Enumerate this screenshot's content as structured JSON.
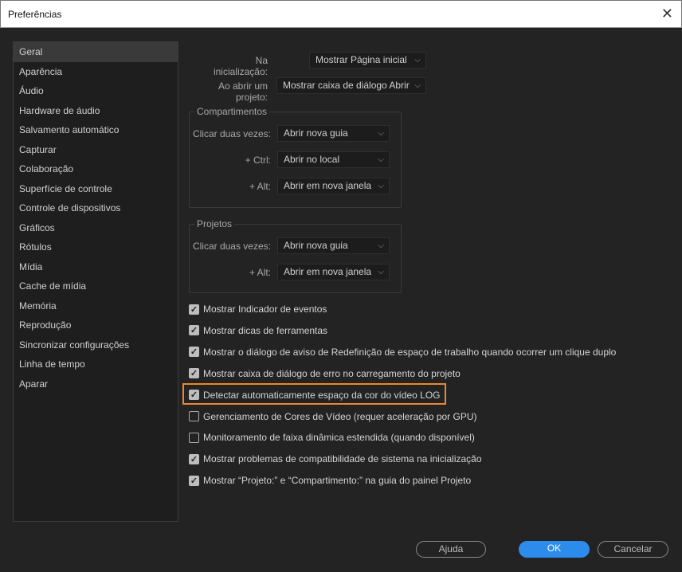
{
  "window": {
    "title": "Preferências"
  },
  "sidebar": {
    "items": [
      "Geral",
      "Aparência",
      "Áudio",
      "Hardware de áudio",
      "Salvamento automático",
      "Capturar",
      "Colaboração",
      "Superfície de controle",
      "Controle de dispositivos",
      "Gráficos",
      "Rótulos",
      "Mídia",
      "Cache de mídia",
      "Memória",
      "Reprodução",
      "Sincronizar configurações",
      "Linha de tempo",
      "Aparar"
    ],
    "selected": "Geral"
  },
  "general": {
    "startup_label": "Na inicialização:",
    "startup_value": "Mostrar Página inicial",
    "open_label": "Ao abrir um projeto:",
    "open_value": "Mostrar caixa de diálogo Abrir"
  },
  "bins": {
    "title": "Compartimentos",
    "rows": [
      {
        "label": "Clicar duas vezes:",
        "value": "Abrir nova guia"
      },
      {
        "label": "+ Ctrl:",
        "value": "Abrir no local"
      },
      {
        "label": "+ Alt:",
        "value": "Abrir em nova janela"
      }
    ]
  },
  "projects": {
    "title": "Projetos",
    "rows": [
      {
        "label": "Clicar duas vezes:",
        "value": "Abrir nova guia"
      },
      {
        "label": "+ Alt:",
        "value": "Abrir em nova janela"
      }
    ]
  },
  "checkboxes": [
    {
      "label": "Mostrar Indicador de eventos",
      "checked": true
    },
    {
      "label": "Mostrar dicas de ferramentas",
      "checked": true
    },
    {
      "label": "Mostrar o diálogo de aviso de Redefinição de espaço de trabalho quando ocorrer um clique duplo",
      "checked": true
    },
    {
      "label": "Mostrar caixa de diálogo de erro no carregamento do projeto",
      "checked": true
    },
    {
      "label": "Detectar automaticamente espaço da cor do vídeo LOG",
      "checked": true
    },
    {
      "label": "Gerenciamento de Cores de Vídeo (requer aceleração por GPU)",
      "checked": false
    },
    {
      "label": "Monitoramento de faixa dinâmica estendida (quando disponível)",
      "checked": false
    },
    {
      "label": "Mostrar problemas de compatibilidade de sistema na inicialização",
      "checked": true
    },
    {
      "label": "Mostrar “Projeto:” e “Compartimento:” na guia do painel Projeto",
      "checked": true
    }
  ],
  "buttons": {
    "help": "Ajuda",
    "ok": "OK",
    "cancel": "Cancelar"
  },
  "colors": {
    "accent": "#2d8ceb",
    "highlight": "#e8892e"
  }
}
